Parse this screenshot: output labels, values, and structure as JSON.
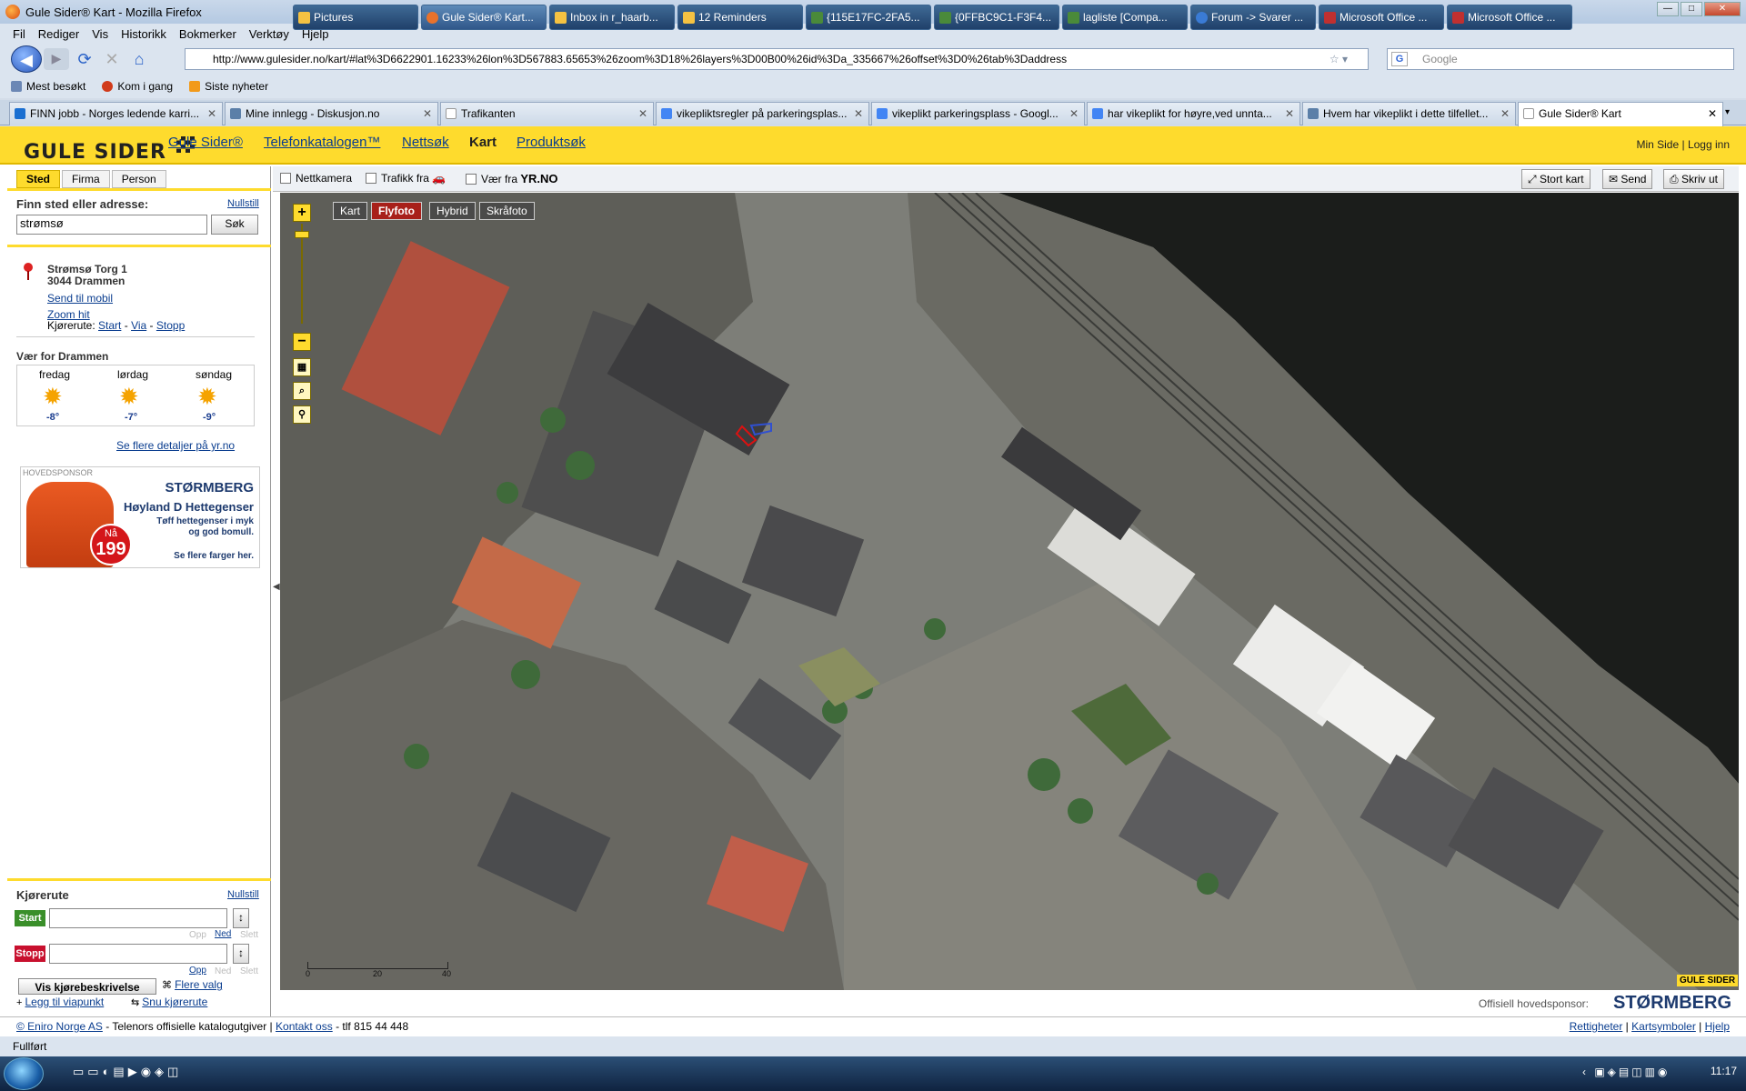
{
  "window": {
    "title": "Gule Sider® Kart - Mozilla Firefox"
  },
  "menu": [
    "Fil",
    "Rediger",
    "Vis",
    "Historikk",
    "Bokmerker",
    "Verktøy",
    "Hjelp"
  ],
  "nav": {
    "url": "http://www.gulesider.no/kart/#lat%3D6622901.16233%26lon%3D567883.65653%26zoom%3D18%26layers%3D00B00%26id%3Da_335667%26offset%3D0%26tab%3Daddress",
    "search_placeholder": "Google"
  },
  "bookmarks": [
    "Mest besøkt",
    "Kom i gang",
    "Siste nyheter"
  ],
  "tabs": [
    {
      "label": "FINN jobb - Norges ledende karri...",
      "color": "#1a6fd1"
    },
    {
      "label": "Mine innlegg - Diskusjon.no",
      "color": "#5b7fa8"
    },
    {
      "label": "Trafikanten",
      "color": "#ffffff"
    },
    {
      "label": "vikepliktsregler på parkeringsplas...",
      "color": "#4285f4"
    },
    {
      "label": "vikeplikt parkeringsplass - Googl...",
      "color": "#4285f4"
    },
    {
      "label": "har vikeplikt for høyre,ved unnta...",
      "color": "#4285f4"
    },
    {
      "label": "Hvem har vikeplikt i dette tilfellet...",
      "color": "#5b7fa8"
    },
    {
      "label": "Gule Sider® Kart",
      "color": "#ffffff"
    }
  ],
  "site": {
    "logo": "GULE SIDER",
    "nav": [
      "Gule Sider®",
      "Telefonkatalogen™",
      "Nettsøk",
      "Kart",
      "Produktsøk"
    ],
    "active_nav": "Kart",
    "min_side": "Min Side",
    "logg_inn": "Logg inn",
    "separator": "|"
  },
  "left": {
    "tabs": [
      "Sted",
      "Firma",
      "Person"
    ],
    "find_label": "Finn sted eller adresse:",
    "reset": "Nullstill",
    "search_value": "strømsø",
    "search_button": "Søk",
    "result": {
      "line1": "Strømsø Torg 1",
      "line2": "3044 Drammen",
      "send_mobil": "Send til mobil",
      "zoom": "Zoom hit",
      "kjorerute": "Kjørerute:",
      "start": "Start",
      "via": "Via",
      "stopp": "Stopp",
      "dash": "-"
    },
    "weather": {
      "title": "Vær for Drammen",
      "days": [
        {
          "day": "fredag",
          "temp": "-8°"
        },
        {
          "day": "lørdag",
          "temp": "-7°"
        },
        {
          "day": "søndag",
          "temp": "-9°"
        }
      ],
      "more": "Se flere detaljer på yr.no"
    },
    "sponsor": {
      "label": "HOVEDSPONSOR",
      "brand": "STØRMBERG",
      "product": "Høyland D Hettegenser",
      "desc1": "Tøff hettegenser i myk",
      "desc2": "og god bomull.",
      "more": "Se flere farger her.",
      "price_now": "Nå",
      "price": "199"
    },
    "route": {
      "title": "Kjørerute",
      "reset": "Nullstill",
      "start": "Start",
      "stopp": "Stopp",
      "opp": "Opp",
      "ned": "Ned",
      "slett": "Slett",
      "show": "Vis kjørebeskrivelse",
      "flere": "Flere valg",
      "legg_til": "Legg til viapunkt",
      "snu": "Snu kjørerute"
    }
  },
  "map": {
    "toolbar": {
      "nettkamera": "Nettkamera",
      "trafikk": "Trafikk fra",
      "vaer": "Vær fra",
      "yr": "YR.NO",
      "stort_kart": "Stort kart",
      "send": "Send",
      "skriv_ut": "Skriv ut"
    },
    "types": [
      "Kart",
      "Flyfoto",
      "Hybrid",
      "Skråfoto"
    ],
    "active_type": "Flyfoto",
    "scale": [
      "0",
      "20",
      "40"
    ],
    "sponsor_label": "Offisiell hovedsponsor:",
    "sponsor_brand": "STØRMBERG",
    "corner_logo": "GULE SIDER"
  },
  "footer": {
    "left": "© Eniro Norge AS",
    "middle": "- Telenors offisielle katalogutgiver |",
    "kontakt": "Kontakt oss",
    "tlf": "- tlf 815 44 448",
    "rettigheter": "Rettigheter",
    "kartsymboler": "Kartsymboler",
    "hjelp": "Hjelp",
    "sep": "|"
  },
  "status": "Fullført",
  "taskbar": {
    "items": [
      {
        "label": "Pictures",
        "color": "#f5c242"
      },
      {
        "label": "Gule Sider® Kart...",
        "color": "#e8722c"
      },
      {
        "label": "Inbox in r_haarb...",
        "color": "#f5c242"
      },
      {
        "label": "12 Reminders",
        "color": "#f5c242"
      },
      {
        "label": "{115E17FC-2FA5...",
        "color": "#4a8a3a"
      },
      {
        "label": "{0FFBC9C1-F3F4...",
        "color": "#4a8a3a"
      },
      {
        "label": "lagliste [Compa...",
        "color": "#4a8a3a"
      },
      {
        "label": "Forum -> Svarer ...",
        "color": "#3a7bd5"
      },
      {
        "label": "Microsoft Office ...",
        "color": "#c03030"
      },
      {
        "label": "Microsoft Office ...",
        "color": "#c03030"
      }
    ],
    "clock": "11:17"
  }
}
